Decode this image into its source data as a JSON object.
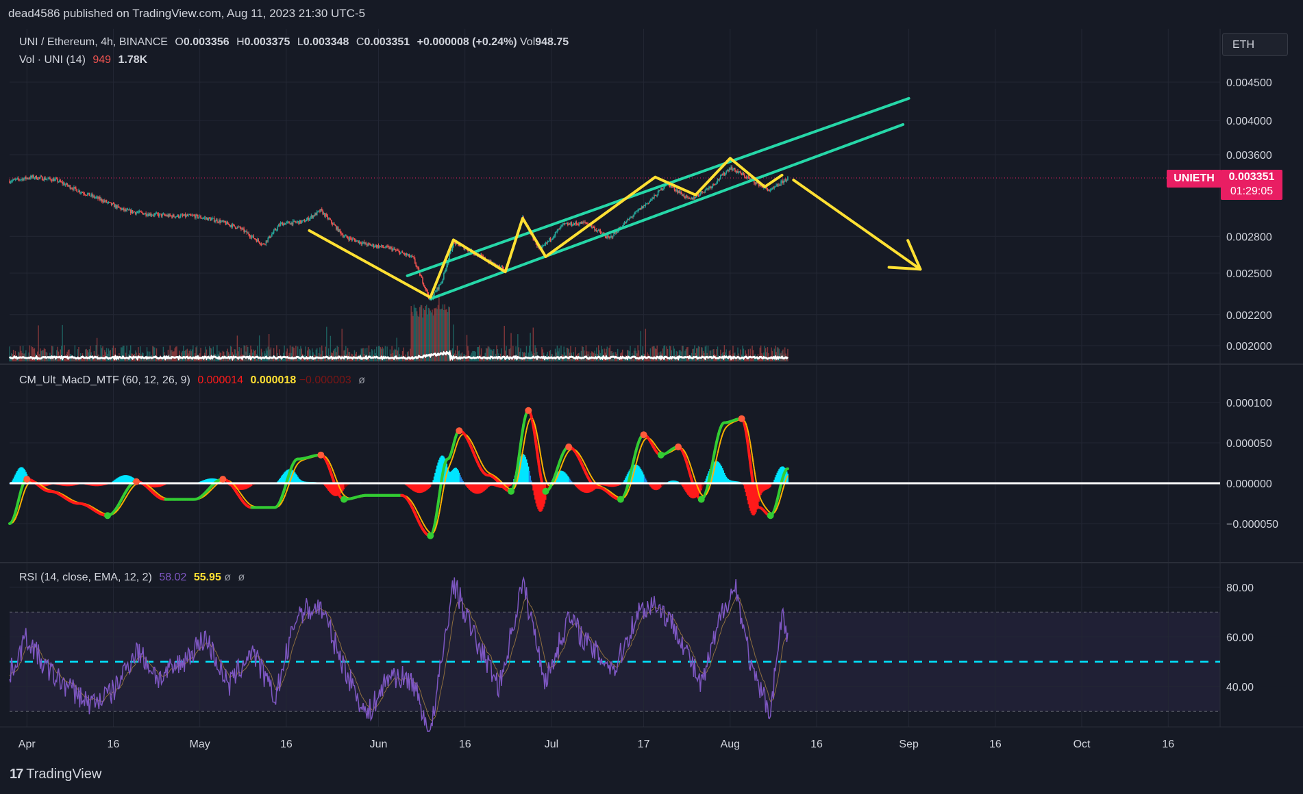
{
  "header": {
    "published": "dead4586 published on TradingView.com, Aug 11, 2023 21:30 UTC-5"
  },
  "price_legend": {
    "symbol": "UNI / Ethereum, 4h, BINANCE",
    "o_label": "O",
    "o": "0.003356",
    "h_label": "H",
    "h": "0.003375",
    "l_label": "L",
    "l": "0.003348",
    "c_label": "C",
    "c": "0.003351",
    "change": "+0.000008 (+0.24%)",
    "vol_label": "Vol",
    "vol": "948.75"
  },
  "vol_legend": {
    "name": "Vol · UNI (14)",
    "v1": "949",
    "v2": "1.78K"
  },
  "macd_legend": {
    "name": "CM_Ult_MacD_MTF (60, 12, 26, 9)",
    "v1": "0.000014",
    "v2": "0.000018",
    "v3": "−0.000003",
    "v4": "ø"
  },
  "rsi_legend": {
    "name": "RSI (14, close, EMA, 12, 2)",
    "v1": "58.02",
    "v2": "55.95",
    "v3": "ø",
    "v4": "ø"
  },
  "currency_button": "ETH",
  "price_badge": {
    "symbol": "UNIETH",
    "price": "0.003351",
    "countdown": "01:29:05"
  },
  "brand": {
    "logo_mark": "17",
    "name": "TradingView"
  },
  "colors": {
    "background": "#161a25",
    "grid": "#232734",
    "channel": "#26d7a8",
    "yellow": "#ffe033",
    "up": "#26a69a",
    "down": "#ef5350",
    "macd_green": "#33cc33",
    "macd_red": "#ff1a1a",
    "hist_blue": "#1e88e5",
    "hist_cyan": "#00e5ff",
    "rsi": "#7e57c2",
    "rsi_mid": "#00e5ff",
    "badge": "#e91e63"
  },
  "chart_data": [
    {
      "type": "candlestick",
      "title": "UNI / Ethereum, 4h, BINANCE",
      "x_tick_labels": [
        "Apr",
        "16",
        "May",
        "16",
        "Jun",
        "16",
        "Jul",
        "17",
        "Aug",
        "16",
        "Sep",
        "16",
        "Oct",
        "16"
      ],
      "x_range": [
        "2023-03-29",
        "2023-10-25"
      ],
      "y_tick_labels": [
        "0.004500",
        "0.004000",
        "0.003600",
        "0.002800",
        "0.002500",
        "0.002200",
        "0.002000"
      ],
      "y_ticks": [
        0.0045,
        0.004,
        0.0036,
        0.0028,
        0.0025,
        0.0022,
        0.002
      ],
      "log_scale": true,
      "last_price": 0.003351,
      "close_path": [
        [
          "2023-03-29",
          0.00332
        ],
        [
          "2023-04-02",
          0.00336
        ],
        [
          "2023-04-06",
          0.00333
        ],
        [
          "2023-04-10",
          0.00322
        ],
        [
          "2023-04-14",
          0.00313
        ],
        [
          "2023-04-18",
          0.00303
        ],
        [
          "2023-04-22",
          0.003
        ],
        [
          "2023-04-26",
          0.00298
        ],
        [
          "2023-04-30",
          0.00298
        ],
        [
          "2023-05-04",
          0.00294
        ],
        [
          "2023-05-08",
          0.00287
        ],
        [
          "2023-05-12",
          0.00273
        ],
        [
          "2023-05-15",
          0.00291
        ],
        [
          "2023-05-19",
          0.00293
        ],
        [
          "2023-05-22",
          0.00303
        ],
        [
          "2023-05-26",
          0.0028
        ],
        [
          "2023-05-30",
          0.00273
        ],
        [
          "2023-06-03",
          0.0027
        ],
        [
          "2023-06-07",
          0.00262
        ],
        [
          "2023-06-10",
          0.0023
        ],
        [
          "2023-06-12",
          0.00244
        ],
        [
          "2023-06-14",
          0.00275
        ],
        [
          "2023-06-18",
          0.00265
        ],
        [
          "2023-06-23",
          0.00252
        ],
        [
          "2023-06-26",
          0.00296
        ],
        [
          "2023-06-29",
          0.00268
        ],
        [
          "2023-07-03",
          0.0029
        ],
        [
          "2023-07-07",
          0.00292
        ],
        [
          "2023-07-11",
          0.00278
        ],
        [
          "2023-07-15",
          0.00298
        ],
        [
          "2023-07-19",
          0.00317
        ],
        [
          "2023-07-21",
          0.0033
        ],
        [
          "2023-07-25",
          0.00313
        ],
        [
          "2023-07-29",
          0.00328
        ],
        [
          "2023-08-01",
          0.00346
        ],
        [
          "2023-08-05",
          0.00332
        ],
        [
          "2023-08-08",
          0.00322
        ],
        [
          "2023-08-11",
          0.00335
        ]
      ],
      "volume_range": [
        0,
        1780
      ],
      "annotations": {
        "channel_upper": [
          [
            "2023-06-06",
            0.00248
          ],
          [
            "2023-09-01",
            0.00428
          ]
        ],
        "channel_lower": [
          [
            "2023-06-10",
            0.00231
          ],
          [
            "2023-08-31",
            0.00395
          ]
        ],
        "yellow_path": [
          [
            "2023-05-20",
            0.00285
          ],
          [
            "2023-06-10",
            0.00232
          ],
          [
            "2023-06-14",
            0.00277
          ],
          [
            "2023-06-23",
            0.00251
          ],
          [
            "2023-06-26",
            0.00296
          ],
          [
            "2023-06-30",
            0.00263
          ],
          [
            "2023-07-19",
            0.00336
          ],
          [
            "2023-07-26",
            0.00318
          ],
          [
            "2023-08-01",
            0.00356
          ],
          [
            "2023-08-07",
            0.00326
          ],
          [
            "2023-08-10",
            0.00338
          ]
        ],
        "yellow_arrow": [
          [
            "2023-08-12",
            0.00333
          ],
          [
            "2023-09-03",
            0.00253
          ]
        ]
      }
    },
    {
      "type": "line",
      "title": "CM_Ult_MacD_MTF (60, 12, 26, 9)",
      "y_tick_labels": [
        "0.000100",
        "0.000050",
        "0.000000",
        "−0.000050"
      ],
      "y_ticks": [
        0.0001,
        5e-05,
        0,
        -5e-05
      ],
      "series": [
        {
          "values": [
            [
              "2023-03-29",
              -5e-05
            ],
            [
              "2023-04-01",
              5e-06
            ],
            [
              "2023-04-05",
              -1e-05
            ],
            [
              "2023-04-10",
              -2.5e-05
            ],
            [
              "2023-04-15",
              -4e-05
            ],
            [
              "2023-04-20",
              2e-06
            ],
            [
              "2023-04-25",
              -2e-05
            ],
            [
              "2023-04-30",
              -2e-05
            ],
            [
              "2023-05-05",
              5e-06
            ],
            [
              "2023-05-10",
              -3e-05
            ],
            [
              "2023-05-14",
              -3e-05
            ],
            [
              "2023-05-18",
              3e-05
            ],
            [
              "2023-05-22",
              3.5e-05
            ],
            [
              "2023-05-26",
              -2e-05
            ],
            [
              "2023-05-30",
              -1.5e-05
            ],
            [
              "2023-06-05",
              -1.5e-05
            ],
            [
              "2023-06-10",
              -6.5e-05
            ],
            [
              "2023-06-13",
              3e-05
            ],
            [
              "2023-06-15",
              6.5e-05
            ],
            [
              "2023-06-20",
              1e-05
            ],
            [
              "2023-06-24",
              -1e-05
            ],
            [
              "2023-06-27",
              9e-05
            ],
            [
              "2023-06-30",
              -1e-05
            ],
            [
              "2023-07-04",
              4.5e-05
            ],
            [
              "2023-07-09",
              -5e-06
            ],
            [
              "2023-07-13",
              -2e-05
            ],
            [
              "2023-07-17",
              6e-05
            ],
            [
              "2023-07-20",
              3.5e-05
            ],
            [
              "2023-07-23",
              4.5e-05
            ],
            [
              "2023-07-27",
              -2e-05
            ],
            [
              "2023-07-31",
              7.5e-05
            ],
            [
              "2023-08-03",
              8e-05
            ],
            [
              "2023-08-06",
              -3e-05
            ],
            [
              "2023-08-08",
              -4e-05
            ],
            [
              "2023-08-11",
              1.8e-05
            ]
          ]
        }
      ]
    },
    {
      "type": "line",
      "title": "RSI (14, close, EMA, 12, 2)",
      "y_tick_labels": [
        "80.00",
        "60.00",
        "40.00"
      ],
      "y_ticks": [
        80,
        60,
        40
      ],
      "bands": {
        "upper": 70,
        "middle": 50,
        "lower": 30
      },
      "series": [
        {
          "values": [
            [
              "2023-03-29",
              45
            ],
            [
              "2023-04-01",
              60
            ],
            [
              "2023-04-04",
              48
            ],
            [
              "2023-04-08",
              40
            ],
            [
              "2023-04-12",
              33
            ],
            [
              "2023-04-16",
              38
            ],
            [
              "2023-04-20",
              55
            ],
            [
              "2023-04-24",
              43
            ],
            [
              "2023-04-28",
              50
            ],
            [
              "2023-05-02",
              60
            ],
            [
              "2023-05-06",
              40
            ],
            [
              "2023-05-10",
              55
            ],
            [
              "2023-05-14",
              35
            ],
            [
              "2023-05-18",
              70
            ],
            [
              "2023-05-22",
              72
            ],
            [
              "2023-05-26",
              48
            ],
            [
              "2023-05-30",
              28
            ],
            [
              "2023-06-03",
              45
            ],
            [
              "2023-06-07",
              42
            ],
            [
              "2023-06-10",
              20
            ],
            [
              "2023-06-14",
              82
            ],
            [
              "2023-06-18",
              58
            ],
            [
              "2023-06-22",
              40
            ],
            [
              "2023-06-26",
              82
            ],
            [
              "2023-06-30",
              42
            ],
            [
              "2023-07-04",
              68
            ],
            [
              "2023-07-08",
              55
            ],
            [
              "2023-07-12",
              47
            ],
            [
              "2023-07-16",
              70
            ],
            [
              "2023-07-19",
              74
            ],
            [
              "2023-07-23",
              62
            ],
            [
              "2023-07-27",
              40
            ],
            [
              "2023-07-31",
              73
            ],
            [
              "2023-08-02",
              80
            ],
            [
              "2023-08-05",
              44
            ],
            [
              "2023-08-08",
              30
            ],
            [
              "2023-08-10",
              70
            ],
            [
              "2023-08-11",
              58
            ]
          ]
        }
      ]
    }
  ]
}
